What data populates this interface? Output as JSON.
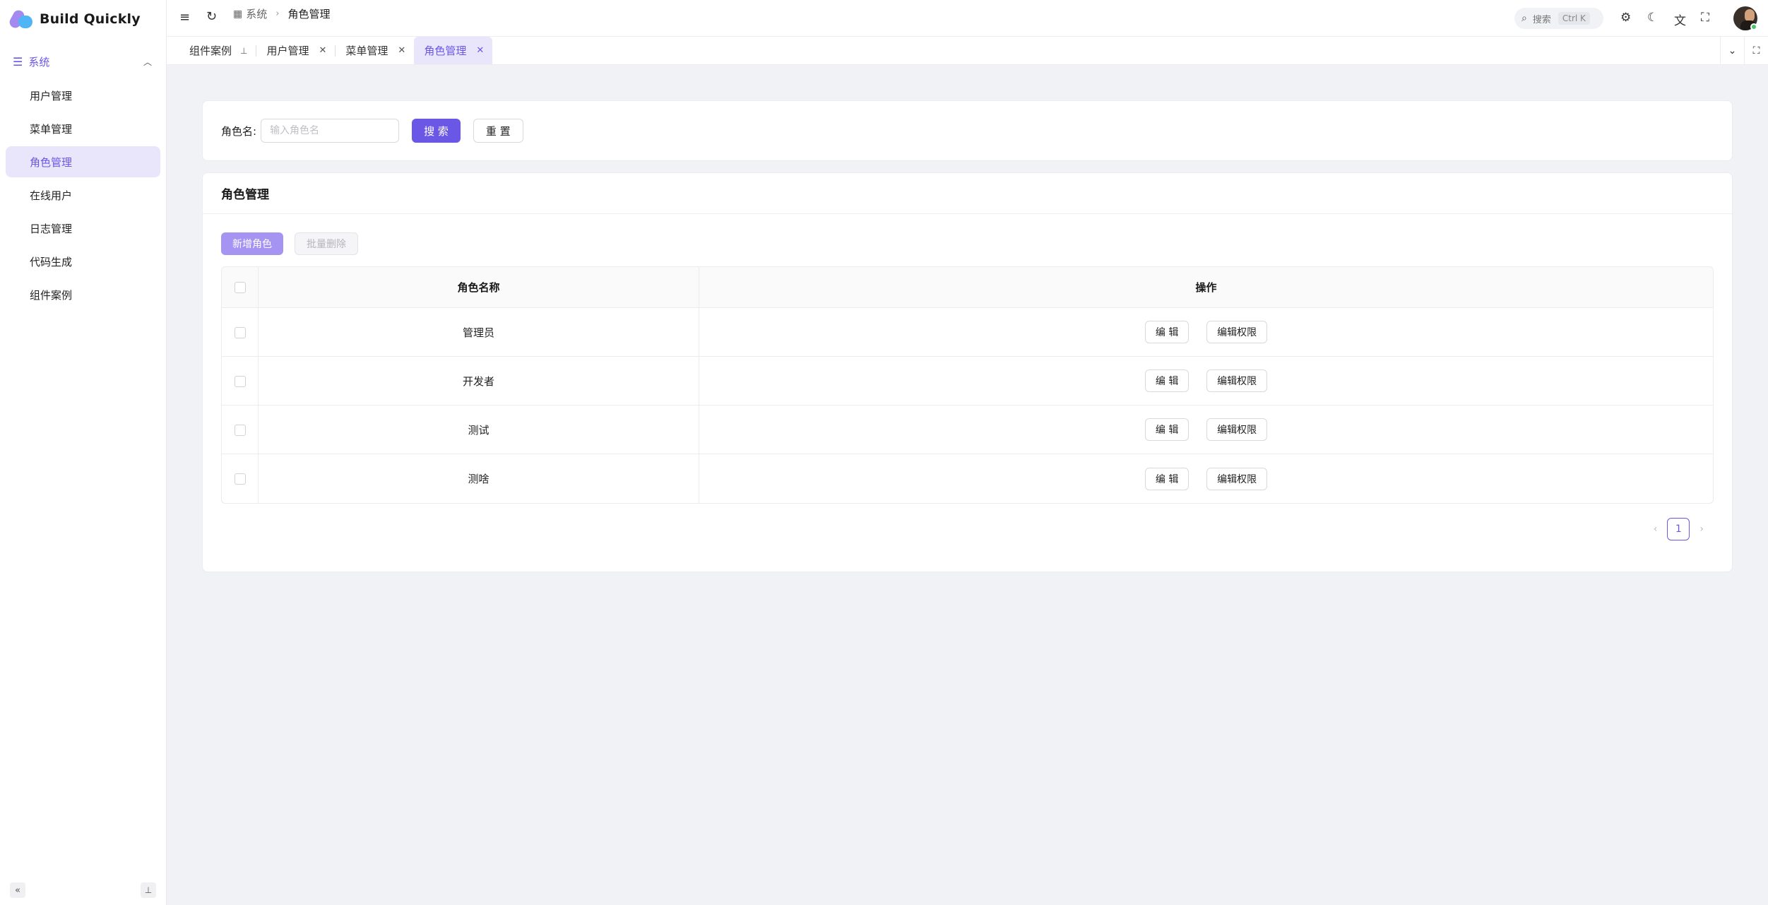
{
  "app": {
    "title": "Build Quickly"
  },
  "sidebar": {
    "group_label": "系统",
    "items": [
      {
        "label": "用户管理",
        "active": false
      },
      {
        "label": "菜单管理",
        "active": false
      },
      {
        "label": "角色管理",
        "active": true
      },
      {
        "label": "在线用户",
        "active": false
      },
      {
        "label": "日志管理",
        "active": false
      },
      {
        "label": "代码生成",
        "active": false
      },
      {
        "label": "组件案例",
        "active": false
      }
    ]
  },
  "header": {
    "breadcrumb": [
      "系统",
      "角色管理"
    ],
    "search_label": "搜索",
    "search_shortcut": "Ctrl K"
  },
  "tabs": [
    {
      "label": "组件案例",
      "pinned": true,
      "active": false
    },
    {
      "label": "用户管理",
      "pinned": false,
      "active": false
    },
    {
      "label": "菜单管理",
      "pinned": false,
      "active": false
    },
    {
      "label": "角色管理",
      "pinned": false,
      "active": true
    }
  ],
  "search_form": {
    "label": "角色名:",
    "placeholder": "输入角色名",
    "search_button": "搜 索",
    "reset_button": "重 置"
  },
  "table_card": {
    "title": "角色管理",
    "add_button": "新增角色",
    "batch_delete_button": "批量删除",
    "columns": [
      "角色名称",
      "操作"
    ],
    "rows": [
      {
        "name": "管理员"
      },
      {
        "name": "开发者"
      },
      {
        "name": "测试"
      },
      {
        "name": "测啥"
      }
    ],
    "row_actions": {
      "edit": "编 辑",
      "edit_permissions": "编辑权限"
    }
  },
  "pagination": {
    "current_page": "1"
  },
  "colors": {
    "accent": "#6b57e6",
    "accent_light": "#e9e6fc"
  }
}
